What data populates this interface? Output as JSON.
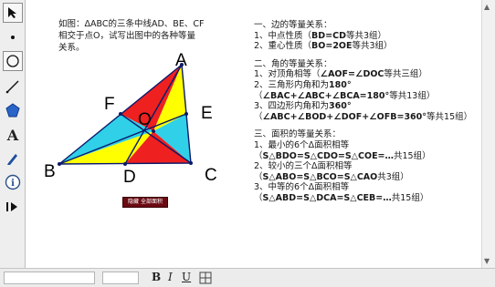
{
  "toolbar": {
    "tools": [
      "select-arrow",
      "point",
      "compass",
      "straightedge",
      "polygon",
      "text",
      "marker",
      "information",
      "custom-tools"
    ]
  },
  "canvas": {
    "intro": [
      "如图：ΔABC的三条中线AD、BE、CF",
      "相交于点O，试写出图中的各种等量",
      "关系。"
    ],
    "sections": [
      {
        "title": "一、边的等量关系：",
        "lines": [
          {
            "pre": "1、中点性质（",
            "bold": "BD=CD",
            "post": "等共3组）"
          },
          {
            "pre": "2、重心性质（",
            "bold": "BO=2OE",
            "post": "等共3组）"
          }
        ]
      },
      {
        "title": "二、角的等量关系：",
        "lines": [
          {
            "pre": "1、对顶角相等（",
            "bold": "∠AOF=∠DOC",
            "post": "等共三组）"
          },
          {
            "pre": "2、三角形内角和为",
            "bold": "180°",
            "post": ""
          },
          {
            "pre": "（",
            "bold": "∠BAC+∠ABC+∠BCA=180°",
            "post": "等共13组）"
          },
          {
            "pre": "3、四边形内角和为",
            "bold": "360°",
            "post": ""
          },
          {
            "pre": "（",
            "bold": "∠ABC+∠BOD+∠DOF+∠OFB=360°",
            "post": "等共15组）"
          }
        ]
      },
      {
        "title": "三、面积的等量关系：",
        "lines": [
          {
            "pre": "1、最小的6个Δ面积相等",
            "bold": "",
            "post": ""
          },
          {
            "pre": "（",
            "bold": "S△BDO=S△CDO=S△COE=…",
            "post": "共15组）"
          },
          {
            "pre": "2、较小的三个Δ面积相等",
            "bold": "",
            "post": ""
          },
          {
            "pre": "（",
            "bold": "S△ABO=S△BCO=S△CAO",
            "post": "共3组）"
          },
          {
            "pre": "3、中等的6个Δ面积相等",
            "bold": "",
            "post": ""
          },
          {
            "pre": "（",
            "bold": "S△ABD=S△DCA=S△CEB=…",
            "post": "共15组）"
          }
        ]
      }
    ],
    "points": {
      "A": "A",
      "B": "B",
      "C": "C",
      "D": "D",
      "E": "E",
      "F": "F",
      "O": "O"
    },
    "button_label": "隐藏 全部面积",
    "fill_colors": {
      "red": "#ee2020",
      "yellow": "#ffff00",
      "cyan": "#2fd0e8"
    }
  },
  "bottombar": {
    "bold": "B",
    "italic": "I",
    "underline": "U"
  }
}
